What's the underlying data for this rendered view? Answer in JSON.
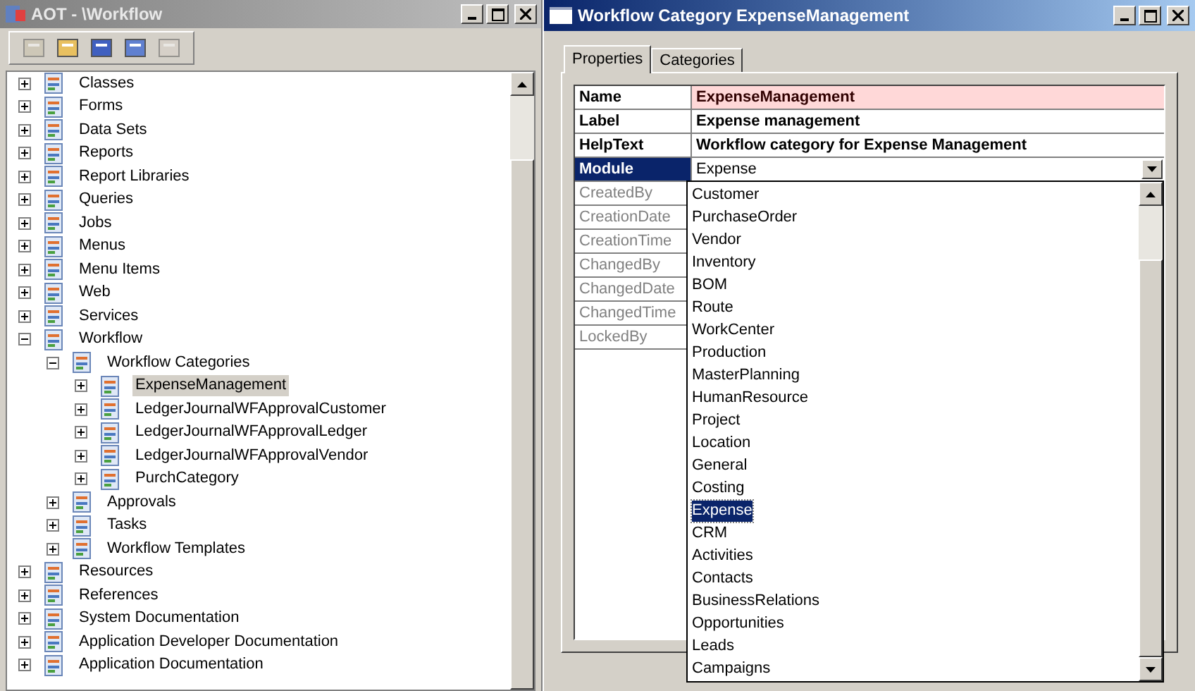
{
  "aot_window": {
    "title": "AOT - \\Workflow",
    "tree": [
      {
        "label": "Classes",
        "expanded": false,
        "selected": false
      },
      {
        "label": "Forms",
        "expanded": false,
        "selected": false
      },
      {
        "label": "Data Sets",
        "expanded": false,
        "selected": false
      },
      {
        "label": "Reports",
        "expanded": false,
        "selected": false
      },
      {
        "label": "Report Libraries",
        "expanded": false,
        "selected": false
      },
      {
        "label": "Queries",
        "expanded": false,
        "selected": false
      },
      {
        "label": "Jobs",
        "expanded": false,
        "selected": false
      },
      {
        "label": "Menus",
        "expanded": false,
        "selected": false
      },
      {
        "label": "Menu Items",
        "expanded": false,
        "selected": false
      },
      {
        "label": "Web",
        "expanded": false,
        "selected": false
      },
      {
        "label": "Services",
        "expanded": false,
        "selected": false
      },
      {
        "label": "Workflow",
        "expanded": true,
        "selected": false,
        "children": [
          {
            "label": "Workflow Categories",
            "expanded": true,
            "selected": false,
            "children": [
              {
                "label": "ExpenseManagement",
                "expanded": false,
                "selected": true
              },
              {
                "label": "LedgerJournalWFApprovalCustomer",
                "expanded": false,
                "selected": false
              },
              {
                "label": "LedgerJournalWFApprovalLedger",
                "expanded": false,
                "selected": false
              },
              {
                "label": "LedgerJournalWFApprovalVendor",
                "expanded": false,
                "selected": false
              },
              {
                "label": "PurchCategory",
                "expanded": false,
                "selected": false
              }
            ]
          },
          {
            "label": "Approvals",
            "expanded": false,
            "selected": false
          },
          {
            "label": "Tasks",
            "expanded": false,
            "selected": false
          },
          {
            "label": "Workflow Templates",
            "expanded": false,
            "selected": false
          }
        ]
      },
      {
        "label": "Resources",
        "expanded": false,
        "selected": false
      },
      {
        "label": "References",
        "expanded": false,
        "selected": false
      },
      {
        "label": "System Documentation",
        "expanded": false,
        "selected": false
      },
      {
        "label": "Application Developer Documentation",
        "expanded": false,
        "selected": false
      },
      {
        "label": "Application Documentation",
        "expanded": false,
        "selected": false
      }
    ]
  },
  "properties_window": {
    "title": "Workflow Category ExpenseManagement",
    "tabs": [
      {
        "label": "Properties",
        "selected": true
      },
      {
        "label": "Categories",
        "selected": false
      }
    ],
    "properties": [
      {
        "name": "Name",
        "value": "ExpenseManagement",
        "changed": true,
        "mandatory": true,
        "selected": false,
        "disabled": false
      },
      {
        "name": "Label",
        "value": "Expense management",
        "changed": true,
        "selected": false,
        "disabled": false
      },
      {
        "name": "HelpText",
        "value": "Workflow category for Expense Management",
        "changed": true,
        "selected": false,
        "disabled": false
      },
      {
        "name": "Module",
        "value": "Expense",
        "kind": "dropdown",
        "changed": true,
        "selected": true,
        "disabled": false
      },
      {
        "name": "CreatedBy",
        "changed": false,
        "selected": false,
        "disabled": true
      },
      {
        "name": "CreationDate",
        "changed": false,
        "selected": false,
        "disabled": true
      },
      {
        "name": "CreationTime",
        "changed": false,
        "selected": false,
        "disabled": true
      },
      {
        "name": "ChangedBy",
        "changed": false,
        "selected": false,
        "disabled": true
      },
      {
        "name": "ChangedDate",
        "changed": false,
        "selected": false,
        "disabled": true
      },
      {
        "name": "ChangedTime",
        "changed": false,
        "selected": false,
        "disabled": true
      },
      {
        "name": "LockedBy",
        "changed": false,
        "selected": false,
        "disabled": true
      }
    ],
    "dropdown_options": [
      {
        "label": "Customer",
        "selected": false
      },
      {
        "label": "PurchaseOrder",
        "selected": false
      },
      {
        "label": "Vendor",
        "selected": false
      },
      {
        "label": "Inventory",
        "selected": false
      },
      {
        "label": "BOM",
        "selected": false
      },
      {
        "label": "Route",
        "selected": false
      },
      {
        "label": "WorkCenter",
        "selected": false
      },
      {
        "label": "Production",
        "selected": false
      },
      {
        "label": "MasterPlanning",
        "selected": false
      },
      {
        "label": "HumanResource",
        "selected": false
      },
      {
        "label": "Project",
        "selected": false
      },
      {
        "label": "Location",
        "selected": false
      },
      {
        "label": "General",
        "selected": false
      },
      {
        "label": "Costing",
        "selected": false
      },
      {
        "label": "Expense",
        "selected": true
      },
      {
        "label": "CRM",
        "selected": false
      },
      {
        "label": "Activities",
        "selected": false
      },
      {
        "label": "Contacts",
        "selected": false
      },
      {
        "label": "BusinessRelations",
        "selected": false
      },
      {
        "label": "Opportunities",
        "selected": false
      },
      {
        "label": "Leads",
        "selected": false
      },
      {
        "label": "Campaigns",
        "selected": false
      }
    ]
  }
}
